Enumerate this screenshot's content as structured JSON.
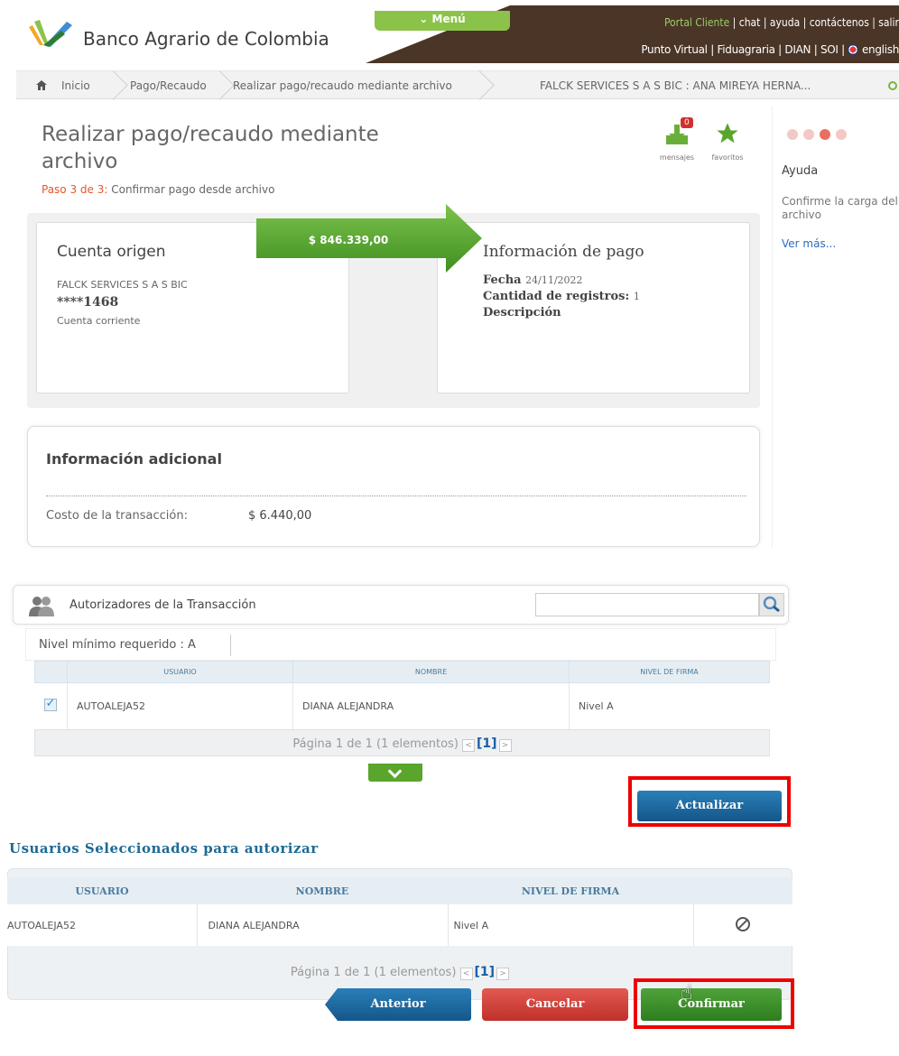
{
  "header": {
    "brand": "Banco Agrario de Colombia",
    "menu_label": "⌄ Menú",
    "links_row1_hl": "Portal Cliente",
    "links_row1_rest": " | chat | ayuda | contáctenos | salir",
    "links_row2": "Punto Virtual | Fiduagraria | DIAN | SOI | ",
    "links_row2_end": " english",
    "colors": {
      "brown": "#4a3527",
      "green": "#8bc34a"
    }
  },
  "breadcrumb": {
    "items": [
      "Inicio",
      "Pago/Recaudo",
      "Realizar pago/recaudo mediante archivo"
    ],
    "account": "FALCK SERVICES S A S BIC : ANA MIREYA HERNA..."
  },
  "page": {
    "title": "Realizar pago/recaudo mediante archivo",
    "step_prefix": "Paso 3 de 3:",
    "step_text": " Confirmar pago desde archivo",
    "messages_label": "mensajes",
    "messages_count": "0",
    "favorites_label": "favoritos"
  },
  "help": {
    "title": "Ayuda",
    "text": "Confirme la carga del archivo",
    "link": "Ver más..."
  },
  "origin": {
    "title": "Cuenta origen",
    "name": "FALCK SERVICES S A S BIC",
    "account": "****1468",
    "type": "Cuenta corriente"
  },
  "transfer_amount": "$ 846.339,00",
  "payment": {
    "title": "Información de pago",
    "date_label": "Fecha",
    "date_value": "24/11/2022",
    "count_label": "Cantidad de registros:",
    "count_value": "1",
    "desc_label": "Descripción"
  },
  "additional": {
    "title": "Información adicional",
    "cost_label": "Costo de la transacción:",
    "cost_value": "$ 6.440,00"
  },
  "authorizers": {
    "title": "Autorizadores de la Transacción",
    "search_placeholder": "",
    "min_level": "Nivel mínimo requerido : A",
    "columns": [
      "USUARIO",
      "NOMBRE",
      "NIVEL DE FIRMA"
    ],
    "rows": [
      {
        "user": "AUTOALEJA52",
        "name": "DIANA ALEJANDRA",
        "level": "Nivel A"
      }
    ],
    "pager_text": "Página 1 de 1 (1 elementos) ",
    "pager_current": "[1]",
    "update_label": "Actualizar"
  },
  "selected": {
    "title": "Usuarios Seleccionados para autorizar",
    "columns": [
      "USUARIO",
      "NOMBRE",
      "NIVEL DE FIRMA"
    ],
    "rows": [
      {
        "user": "AUTOALEJA52",
        "name": "DIANA ALEJANDRA",
        "level": "Nivel A"
      }
    ],
    "pager_text": "Página 1 de 1 (1 elementos) ",
    "pager_current": "[1]"
  },
  "actions": {
    "prev": "Anterior",
    "cancel": "Cancelar",
    "confirm": "Confirmar"
  }
}
